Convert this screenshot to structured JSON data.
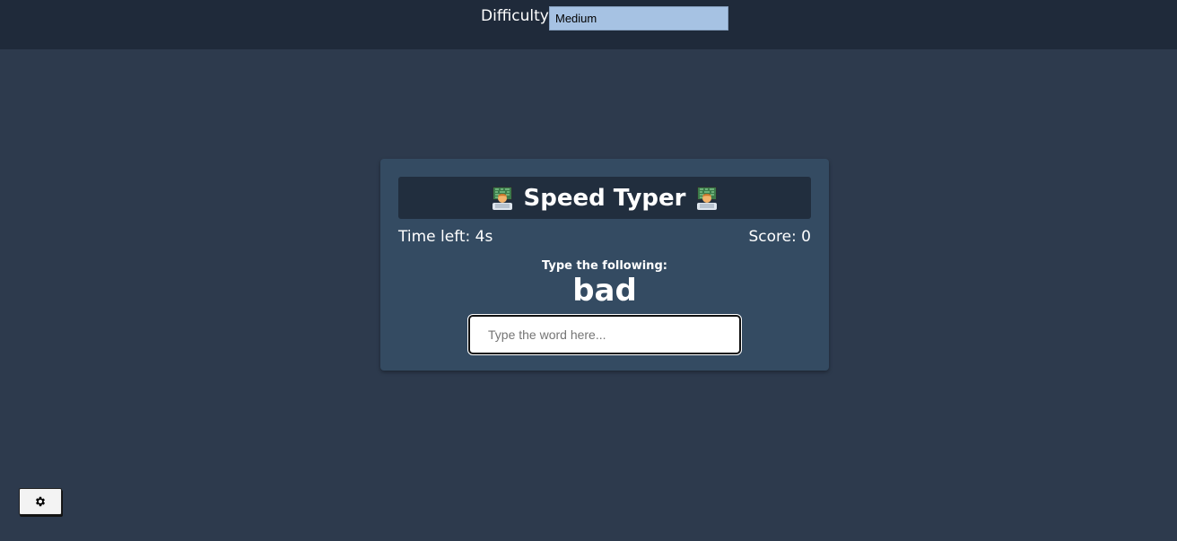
{
  "header": {
    "difficulty_label": "Difficulty",
    "difficulty_value": "Medium"
  },
  "game": {
    "title": "Speed Typer",
    "title_icon": "technologist-emoji-icon",
    "time_left": "Time left: 4s",
    "score": "Score: 0",
    "prompt_label": "Type the following:",
    "target_word": "bad",
    "input_placeholder": "Type the word here...",
    "input_value": ""
  },
  "settings": {
    "icon": "gear-icon"
  },
  "colors": {
    "page_bg": "#2d3a4d",
    "topbar_bg": "#1f2a3a",
    "card_bg": "#344b62",
    "title_bg": "#212e3e",
    "select_bg": "#a6c2e3"
  }
}
